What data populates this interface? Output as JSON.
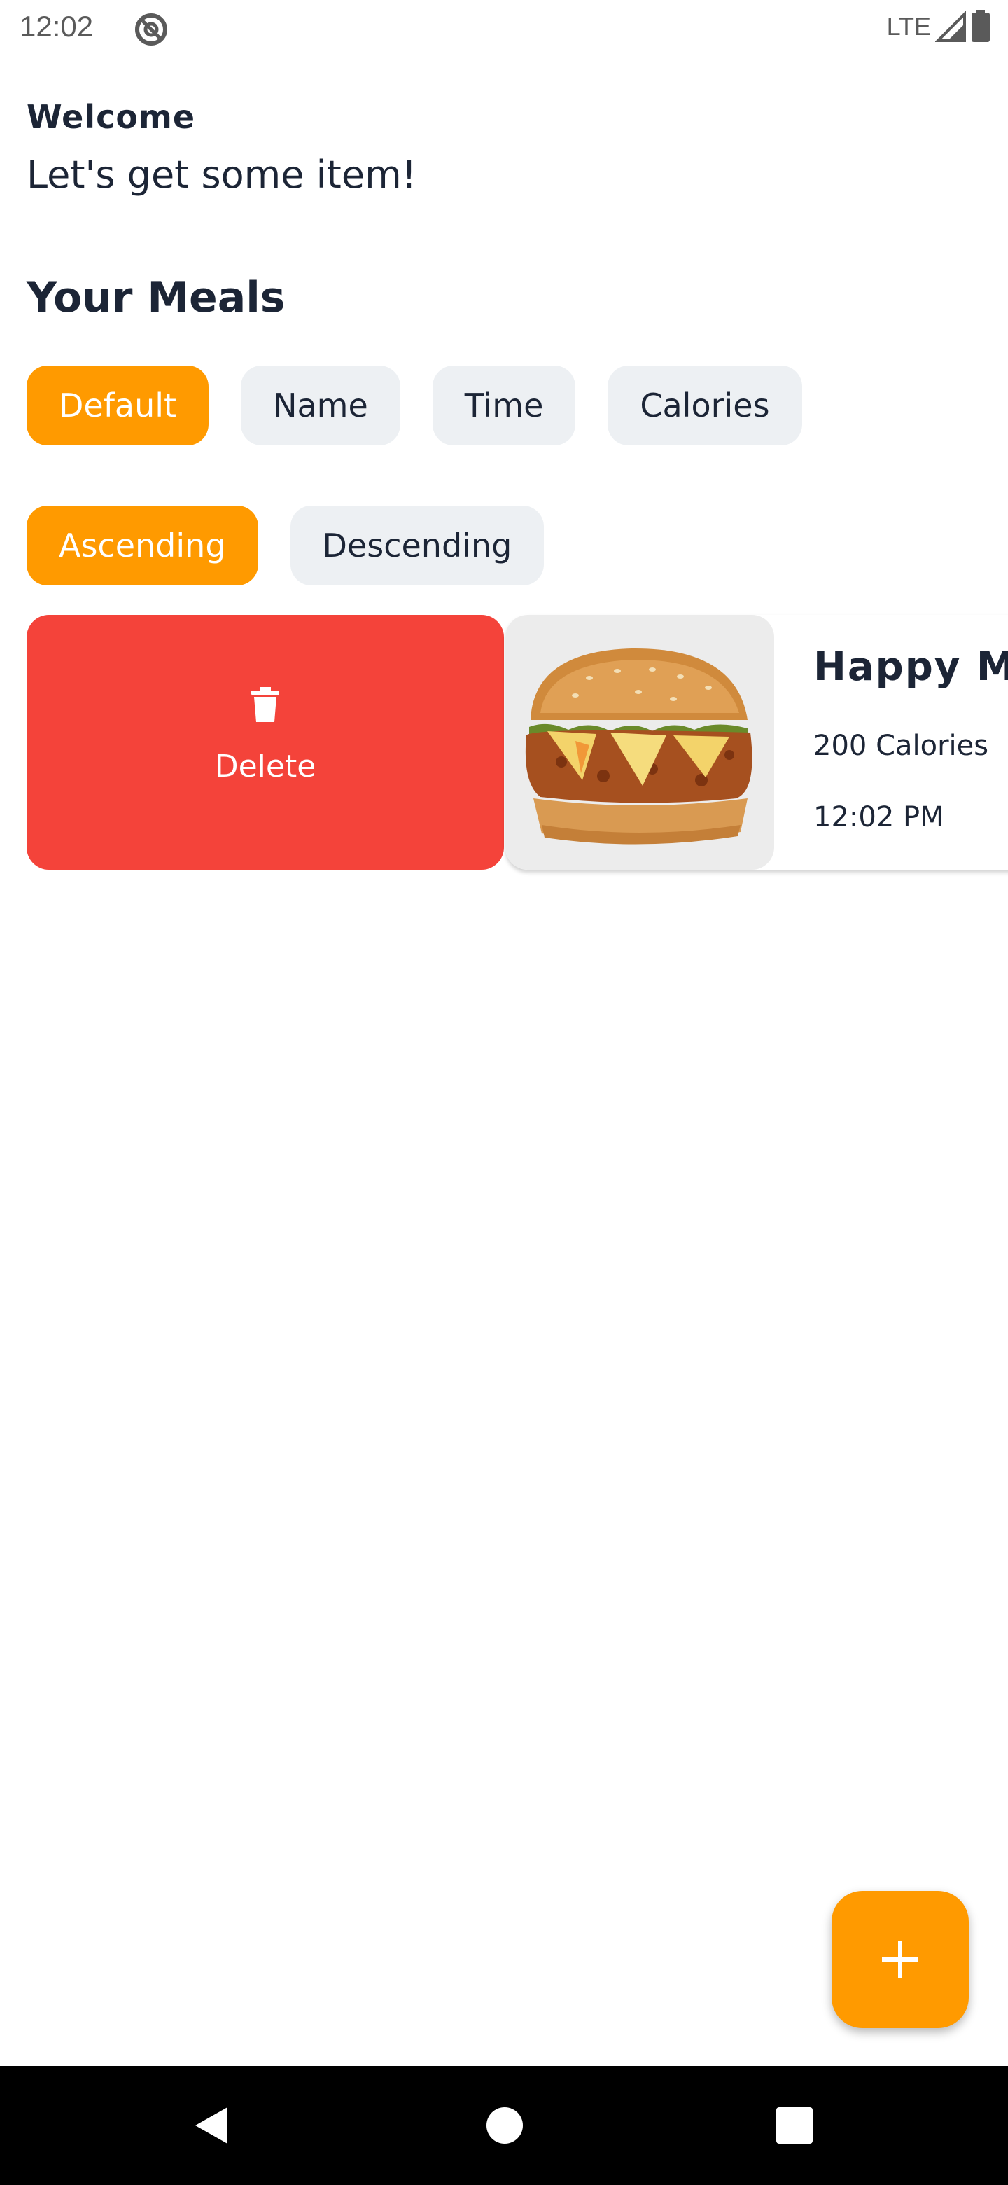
{
  "status_bar": {
    "time": "12:02",
    "network": "LTE"
  },
  "header": {
    "welcome": "Welcome",
    "subtitle": "Let's get some item!"
  },
  "meals_section": {
    "title": "Your Meals",
    "sort_fields": [
      {
        "label": "Default",
        "active": true
      },
      {
        "label": "Name",
        "active": false
      },
      {
        "label": "Time",
        "active": false
      },
      {
        "label": "Calories",
        "active": false
      }
    ],
    "sort_order": [
      {
        "label": "Ascending",
        "active": true
      },
      {
        "label": "Descending",
        "active": false
      }
    ],
    "items": [
      {
        "name": "Happy M",
        "calories": "200 Calories",
        "time": "12:02 PM",
        "delete_label": "Delete",
        "image_icon": "burger-image"
      }
    ]
  },
  "fab": {
    "icon": "plus-icon"
  },
  "colors": {
    "accent": "#ff9a00",
    "delete": "#f4433a",
    "chip_inactive": "#edf0f3",
    "text": "#1c2536"
  },
  "nav": {
    "back_icon": "back-triangle-icon",
    "home_icon": "home-circle-icon",
    "recents_icon": "recents-square-icon"
  }
}
